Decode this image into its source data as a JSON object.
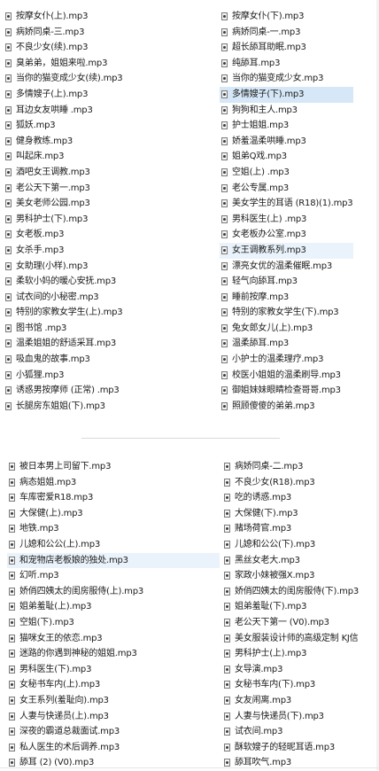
{
  "top_panel": {
    "left": [
      {
        "name": "按摩女仆(上).mp3"
      },
      {
        "name": "病娇同桌-三.mp3"
      },
      {
        "name": "不良少女(续).mp3"
      },
      {
        "name": "臭弟弟，姐姐来啦.mp3"
      },
      {
        "name": "当你的猫变成少女(续).mp3"
      },
      {
        "name": "多情嫂子(上).mp3"
      },
      {
        "name": "耳边女友哄睡 .mp3"
      },
      {
        "name": "狐妖.mp3"
      },
      {
        "name": "健身教练.mp3"
      },
      {
        "name": "叫起床.mp3"
      },
      {
        "name": "酒吧女王调教.mp3"
      },
      {
        "name": "老公天下第一.mp3"
      },
      {
        "name": "美女老师公园.mp3"
      },
      {
        "name": "男科护士(下).mp3"
      },
      {
        "name": "女老板.mp3"
      },
      {
        "name": "女杀手.mp3"
      },
      {
        "name": "女助理(小样).mp3"
      },
      {
        "name": "柔软小妈的暖心安抚.mp3"
      },
      {
        "name": "试衣间的小秘密.mp3"
      },
      {
        "name": "特别的家教女学生(上).mp3"
      },
      {
        "name": "图书馆 .mp3"
      },
      {
        "name": "温柔姐姐的舒适采耳.mp3"
      },
      {
        "name": "吸血鬼的故事.mp3"
      },
      {
        "name": "小狐狸.mp3"
      },
      {
        "name": "诱惑男按摩师 (正常) .mp3"
      },
      {
        "name": "长腿房东姐姐(下).mp3"
      }
    ],
    "right": [
      {
        "name": "按摩女仆(下).mp3"
      },
      {
        "name": "病娇同桌-一.mp3"
      },
      {
        "name": "超长舔耳助眠.mp3"
      },
      {
        "name": "纯舔耳.mp3"
      },
      {
        "name": "当你的猫变成少女.mp3"
      },
      {
        "name": "多情嫂子(下).mp3",
        "selected": true
      },
      {
        "name": "狗狗和主人.mp3"
      },
      {
        "name": "护士姐姐.mp3"
      },
      {
        "name": "娇羞温柔哄睡.mp3"
      },
      {
        "name": "姐弟Q戏.mp3"
      },
      {
        "name": "空姐(上) .mp3"
      },
      {
        "name": "老公专属.mp3"
      },
      {
        "name": "美女学生的耳语 (R18)(1).mp3"
      },
      {
        "name": "男科医生(上) .mp3"
      },
      {
        "name": "女老板办公室.mp3"
      },
      {
        "name": "女王调教系列.mp3",
        "hover": true
      },
      {
        "name": "漂亮女优的温柔催眠.mp3"
      },
      {
        "name": "轻气向舔耳.mp3"
      },
      {
        "name": "睡前按摩.mp3"
      },
      {
        "name": "特别的家教女学生(下).mp3"
      },
      {
        "name": "兔女郎女儿(上).mp3"
      },
      {
        "name": "温柔舔耳.mp3"
      },
      {
        "name": "小护士的温柔理疗.mp3"
      },
      {
        "name": "校医小姐姐的温柔刷导.mp3"
      },
      {
        "name": "御姐妹妹眼睛检查哥哥.mp3"
      },
      {
        "name": "照顾傻傻的弟弟.mp3"
      }
    ]
  },
  "bottom_panel": {
    "left": [
      {
        "name": "被日本男上司留下.mp3"
      },
      {
        "name": "病态姐姐.mp3"
      },
      {
        "name": "车库密爱R18.mp3"
      },
      {
        "name": "大保健(上).mp3"
      },
      {
        "name": "地铁.mp3"
      },
      {
        "name": "儿媳和公公(上).mp3"
      },
      {
        "name": "和宠物店老板娘的独处.mp3",
        "hover": true
      },
      {
        "name": "幻听.mp3"
      },
      {
        "name": "娇俏四姨太的闺房服侍(上).mp3"
      },
      {
        "name": "姐弟羞耻(上).mp3"
      },
      {
        "name": "空姐(下).mp3"
      },
      {
        "name": "猫咪女王的依恋.mp3"
      },
      {
        "name": "迷路的你遇到神秘的姐姐.mp3"
      },
      {
        "name": "男科医生(下).mp3"
      },
      {
        "name": "女秘书车内(上).mp3"
      },
      {
        "name": "女王系列(羞耻向).mp3"
      },
      {
        "name": "人妻与快递员(上).mp3"
      },
      {
        "name": "深夜的霸道总裁面试.mp3"
      },
      {
        "name": "私人医生的术后调养.mp3"
      },
      {
        "name": "舔耳 (2) (V0).mp3"
      }
    ],
    "right": [
      {
        "name": "病娇同桌-二.mp3"
      },
      {
        "name": "不良少女(R18).mp3"
      },
      {
        "name": "吃的诱惑.mp3"
      },
      {
        "name": "大保健(下).mp3"
      },
      {
        "name": "赌场荷官.mp3"
      },
      {
        "name": "儿媳和公公(下).mp3"
      },
      {
        "name": "黑丝女老大.mp3"
      },
      {
        "name": "家政小妹被强X.mp3"
      },
      {
        "name": "娇俏四姨太的闺房服侍(下).mp3"
      },
      {
        "name": "姐弟羞耻(下).mp3"
      },
      {
        "name": "老公天下第一 (V0).mp3"
      },
      {
        "name": "美女服装设计师的高级定制  KJ信"
      },
      {
        "name": "男科护士(上).mp3"
      },
      {
        "name": "女导演.mp3"
      },
      {
        "name": "女秘书车内(下).mp3"
      },
      {
        "name": "女友闹离.mp3"
      },
      {
        "name": "人妻与快递员(下).mp3"
      },
      {
        "name": "试衣间.mp3"
      },
      {
        "name": "酥软嫂子的轻昵耳语.mp3"
      },
      {
        "name": "舔耳吹气.mp3"
      }
    ]
  }
}
